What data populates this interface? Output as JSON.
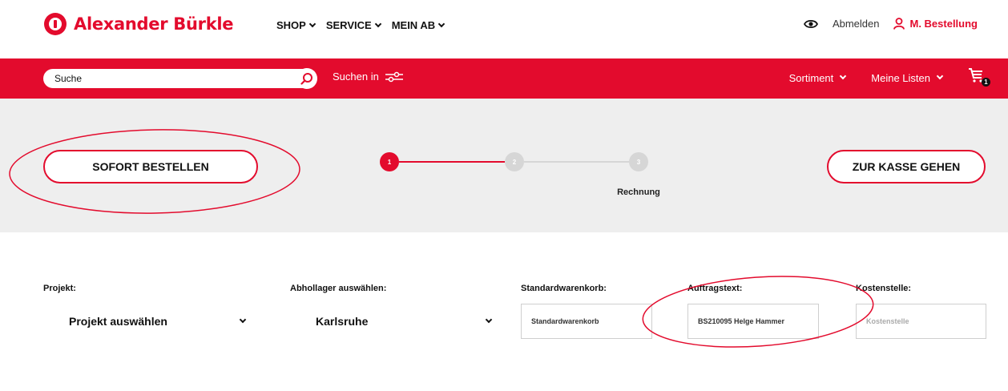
{
  "header": {
    "logo_text": "Alexander Bürkle",
    "nav": [
      {
        "label": "SHOP"
      },
      {
        "label": "SERVICE"
      },
      {
        "label": "MEIN AB"
      }
    ],
    "logout_label": "Abmelden",
    "account_label": "M. Bestellung"
  },
  "searchbar": {
    "placeholder": "Suche",
    "search_in_label": "Suchen in",
    "assortment_label": "Sortiment",
    "lists_label": "Meine Listen",
    "cart_count": "1"
  },
  "checkout": {
    "order_now_label": "SOFORT BESTELLEN",
    "to_checkout_label": "ZUR KASSE GEHEN",
    "steps": [
      {
        "number": "1",
        "state": "active"
      },
      {
        "number": "2",
        "state": "inactive"
      },
      {
        "number": "3",
        "state": "inactive"
      }
    ],
    "step_label": "Rechnung"
  },
  "form": {
    "project": {
      "label": "Projekt:",
      "value": "Projekt auswählen"
    },
    "pickup": {
      "label": "Abhollager auswählen:",
      "value": "Karlsruhe"
    },
    "default_cart": {
      "label": "Standardwarenkorb:",
      "value": "Standardwarenkorb"
    },
    "order_text": {
      "label": "Auftragstext:",
      "value": "BS210095 Helge Hammer"
    },
    "cost_center": {
      "label": "Kostenstelle:",
      "placeholder": "Kostenstelle"
    }
  },
  "colors": {
    "brand_red": "#e30b2d",
    "band_grey": "#eeeeee",
    "step_inactive": "#d6d6d6"
  },
  "icons": [
    "eye-icon",
    "user-icon",
    "search-icon",
    "filter-icon",
    "cart-icon",
    "chevron-down-icon"
  ]
}
